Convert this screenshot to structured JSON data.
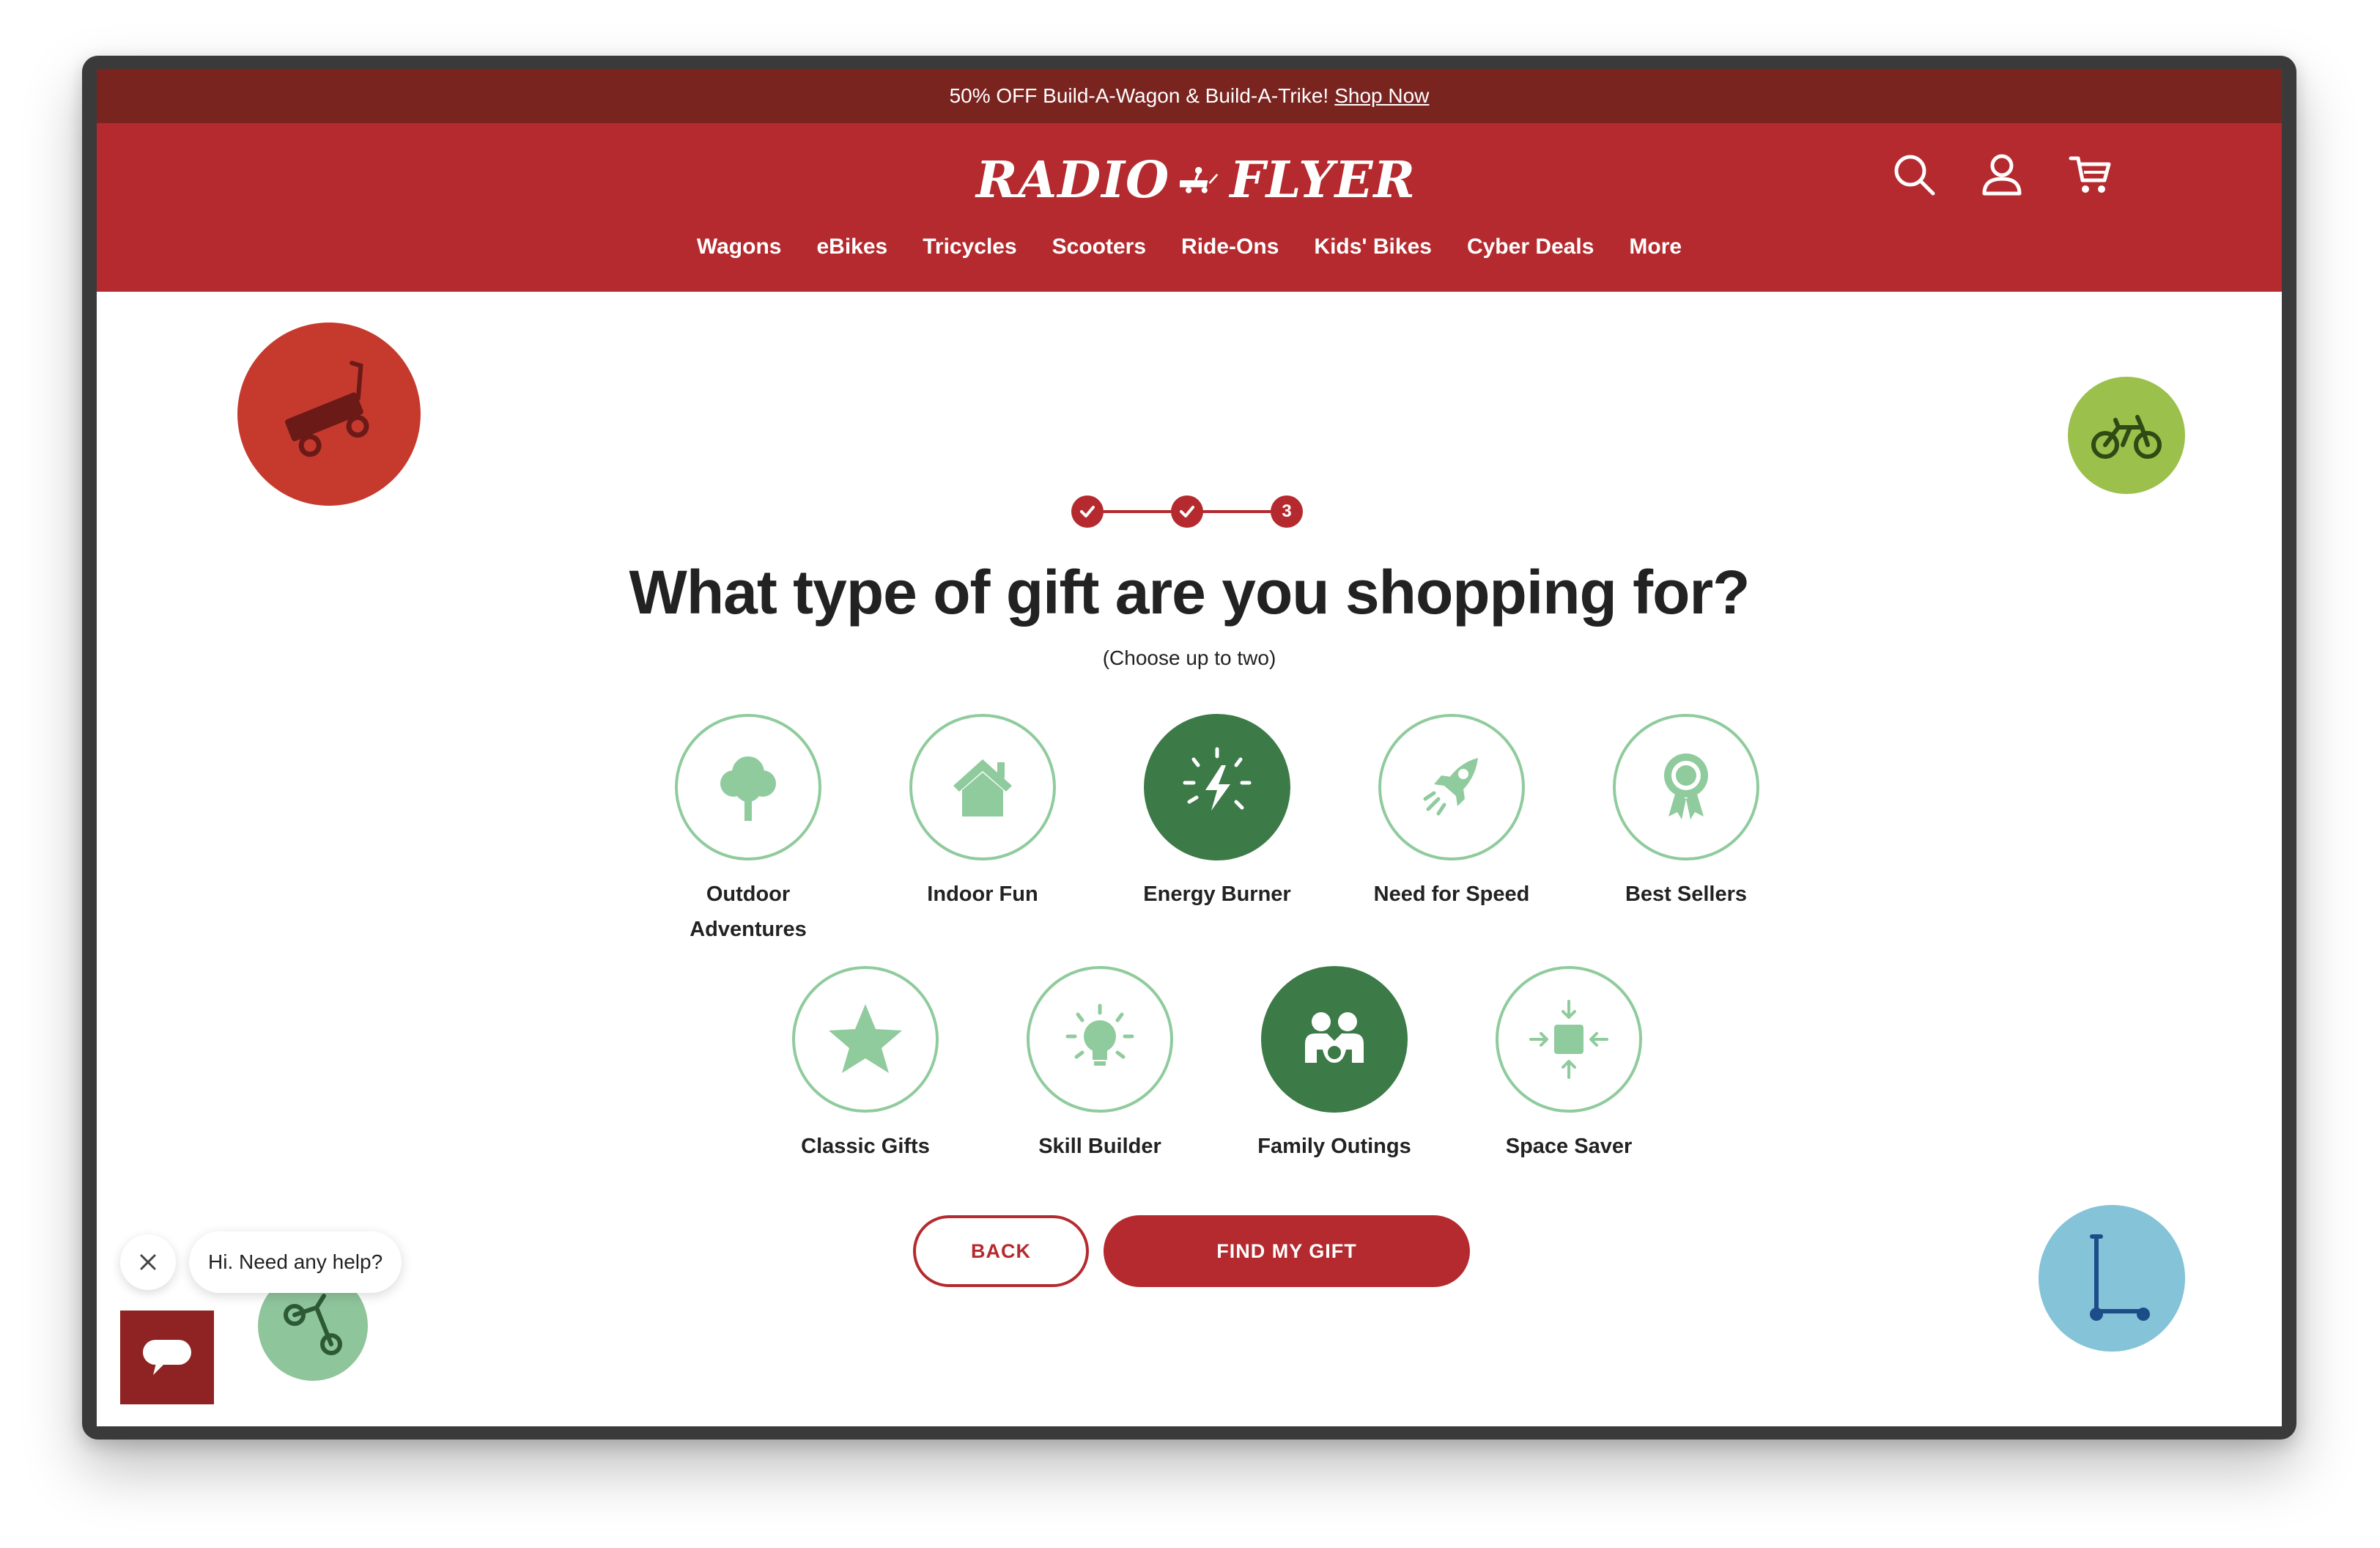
{
  "promo": {
    "text": "50% OFF Build-A-Wagon & Build-A-Trike!",
    "link": "Shop Now"
  },
  "brand": {
    "left": "RADIO",
    "right": "FLYER"
  },
  "nav": [
    "Wagons",
    "eBikes",
    "Tricycles",
    "Scooters",
    "Ride-Ons",
    "Kids' Bikes",
    "Cyber Deals",
    "More"
  ],
  "stepper": {
    "current": "3"
  },
  "quiz": {
    "title": "What type of gift are you shopping for?",
    "subtitle": "(Choose up to two)",
    "options": [
      {
        "label": "Outdoor Adventures",
        "icon": "tree-icon",
        "selected": false
      },
      {
        "label": "Indoor Fun",
        "icon": "house-icon",
        "selected": false
      },
      {
        "label": "Energy Burner",
        "icon": "lightning-icon",
        "selected": true
      },
      {
        "label": "Need for Speed",
        "icon": "rocket-icon",
        "selected": false
      },
      {
        "label": "Best Sellers",
        "icon": "award-ribbon-icon",
        "selected": false
      },
      {
        "label": "Classic Gifts",
        "icon": "star-icon",
        "selected": false
      },
      {
        "label": "Skill Builder",
        "icon": "lightbulb-icon",
        "selected": false
      },
      {
        "label": "Family Outings",
        "icon": "family-icon",
        "selected": true
      },
      {
        "label": "Space Saver",
        "icon": "compact-arrows-icon",
        "selected": false
      }
    ]
  },
  "buttons": {
    "back": "BACK",
    "find": "FIND MY GIFT"
  },
  "chat": {
    "greeting": "Hi. Need any help?"
  },
  "colors": {
    "brand_red": "#b52a2e",
    "promo_dark": "#7a2420",
    "selected_green": "#3c7a47",
    "light_green": "#8fcb9c"
  }
}
